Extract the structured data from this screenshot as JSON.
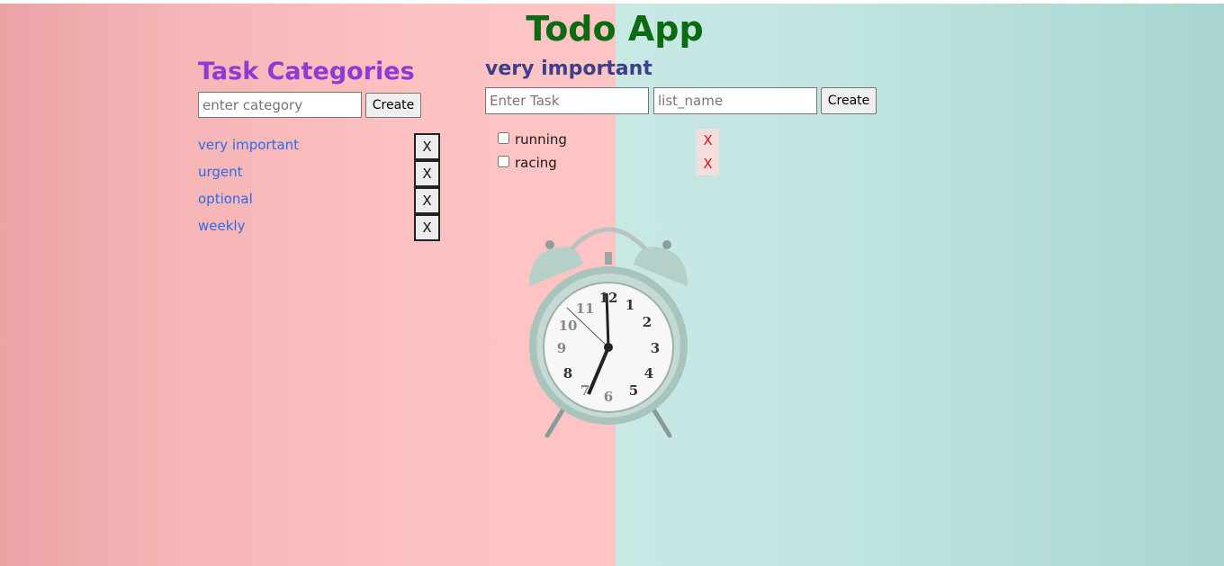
{
  "app": {
    "title": "Todo App"
  },
  "categories": {
    "heading": "Task Categories",
    "input_placeholder": "enter category",
    "create_label": "Create",
    "delete_label": "X",
    "items": [
      {
        "label": "very important"
      },
      {
        "label": "urgent"
      },
      {
        "label": "optional"
      },
      {
        "label": "weekly"
      }
    ]
  },
  "list": {
    "heading": "very important",
    "task_placeholder": "Enter Task",
    "list_name_placeholder": "list_name",
    "create_label": "Create",
    "delete_label": "X",
    "tasks": [
      {
        "label": "running",
        "checked": false
      },
      {
        "label": "racing",
        "checked": false
      }
    ]
  },
  "background": {
    "left_color": "#ffc4c4",
    "right_color": "#b2dcd7",
    "image": "alarm-clock"
  },
  "colors": {
    "title": "#0b6b10",
    "category_heading": "#8e3ad6",
    "category_link": "#2c6ae6",
    "list_heading": "#3e3e8a",
    "delete_red": "#e0101a"
  }
}
